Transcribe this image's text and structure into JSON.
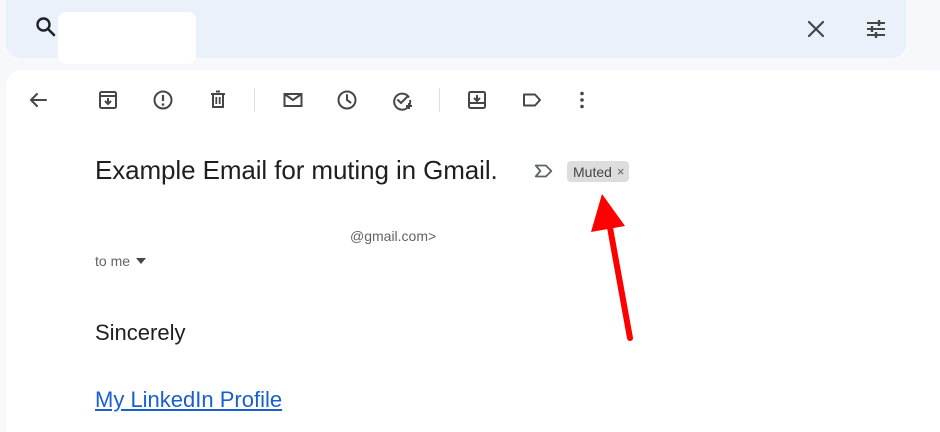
{
  "search": {
    "value": "",
    "clear_icon": "close-icon",
    "options_icon": "tune-icon"
  },
  "toolbar": {
    "icons": [
      "back-arrow-icon",
      "archive-icon",
      "report-spam-icon",
      "delete-icon",
      "mark-unread-icon",
      "snooze-icon",
      "add-task-icon",
      "move-to-icon",
      "label-icon",
      "more-options-icon"
    ]
  },
  "email": {
    "subject": "Example Email for muting in Gmail.",
    "label_chip": "Muted",
    "label_chip_remove": "×",
    "sender_email": "@gmail.com>",
    "recipient": "to me",
    "body": {
      "signoff": "Sincerely",
      "link_text": "My LinkedIn Profile"
    }
  },
  "colors": {
    "search_bar_bg": "#eaf1fb",
    "chip_bg": "#dddddd",
    "link": "#1a5fd0",
    "annotation_arrow": "#ff0000"
  }
}
